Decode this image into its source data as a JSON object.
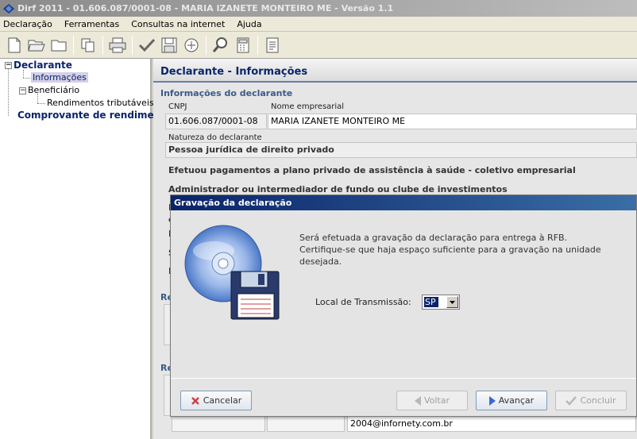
{
  "window": {
    "title": "Dirf 2011 - 01.606.087/0001-08 - MARIA IZANETE MONTEIRO ME - Versão 1.1"
  },
  "menu": {
    "items": [
      "Declaração",
      "Ferramentas",
      "Consultas na internet",
      "Ajuda"
    ]
  },
  "toolbar": {
    "buttons": [
      "new-document-icon",
      "open-folder-icon",
      "folder-icon",
      "copy-icon",
      "print-icon",
      "check-icon",
      "save-disk-icon",
      "transmit-icon",
      "search-icon",
      "calculator-icon",
      "report-icon"
    ]
  },
  "tree": {
    "declarante": "Declarante",
    "informacoes": "Informações",
    "beneficiario": "Beneficiário",
    "rendimentos": "Rendimentos tributáveis",
    "comprovante": "Comprovante de rendimentos"
  },
  "content": {
    "title": "Declarante - Informações",
    "section_info": "Informações do declarante",
    "cnpj_label": "CNPJ",
    "cnpj_value": "01.606.087/0001-08",
    "nome_label": "Nome empresarial",
    "nome_value": "MARIA IZANETE MONTEIRO ME",
    "natureza_label": "Natureza do declarante",
    "natureza_value": "Pessoa jurídica de direito privado",
    "efetuou": "Efetuou pagamentos a plano privado de assistência à saúde - coletivo empresarial",
    "administrador": "Administrador ou intermediador de fundo ou clube de investimentos",
    "partial_letters": [
      "I",
      "c",
      "I",
      "S",
      "I"
    ],
    "section_re1": "Re",
    "section_re2": "Re",
    "email_value": "2004@infornety.com.br"
  },
  "dialog": {
    "title": "Gravação da declaração",
    "message_lines": [
      "Será efetuada a gravação da declaração para entrega à RFB.",
      "Certifique-se que haja espaço suficiente para a gravação na unidade",
      "desejada."
    ],
    "local_label": "Local de Transmissão:",
    "local_value": "SP",
    "buttons": {
      "cancelar": "Cancelar",
      "voltar": "Voltar",
      "avancar": "Avançar",
      "concluir": "Concluir"
    }
  },
  "colors": {
    "accent": "#0a246a",
    "title_gradient_start": "#0a246a"
  }
}
